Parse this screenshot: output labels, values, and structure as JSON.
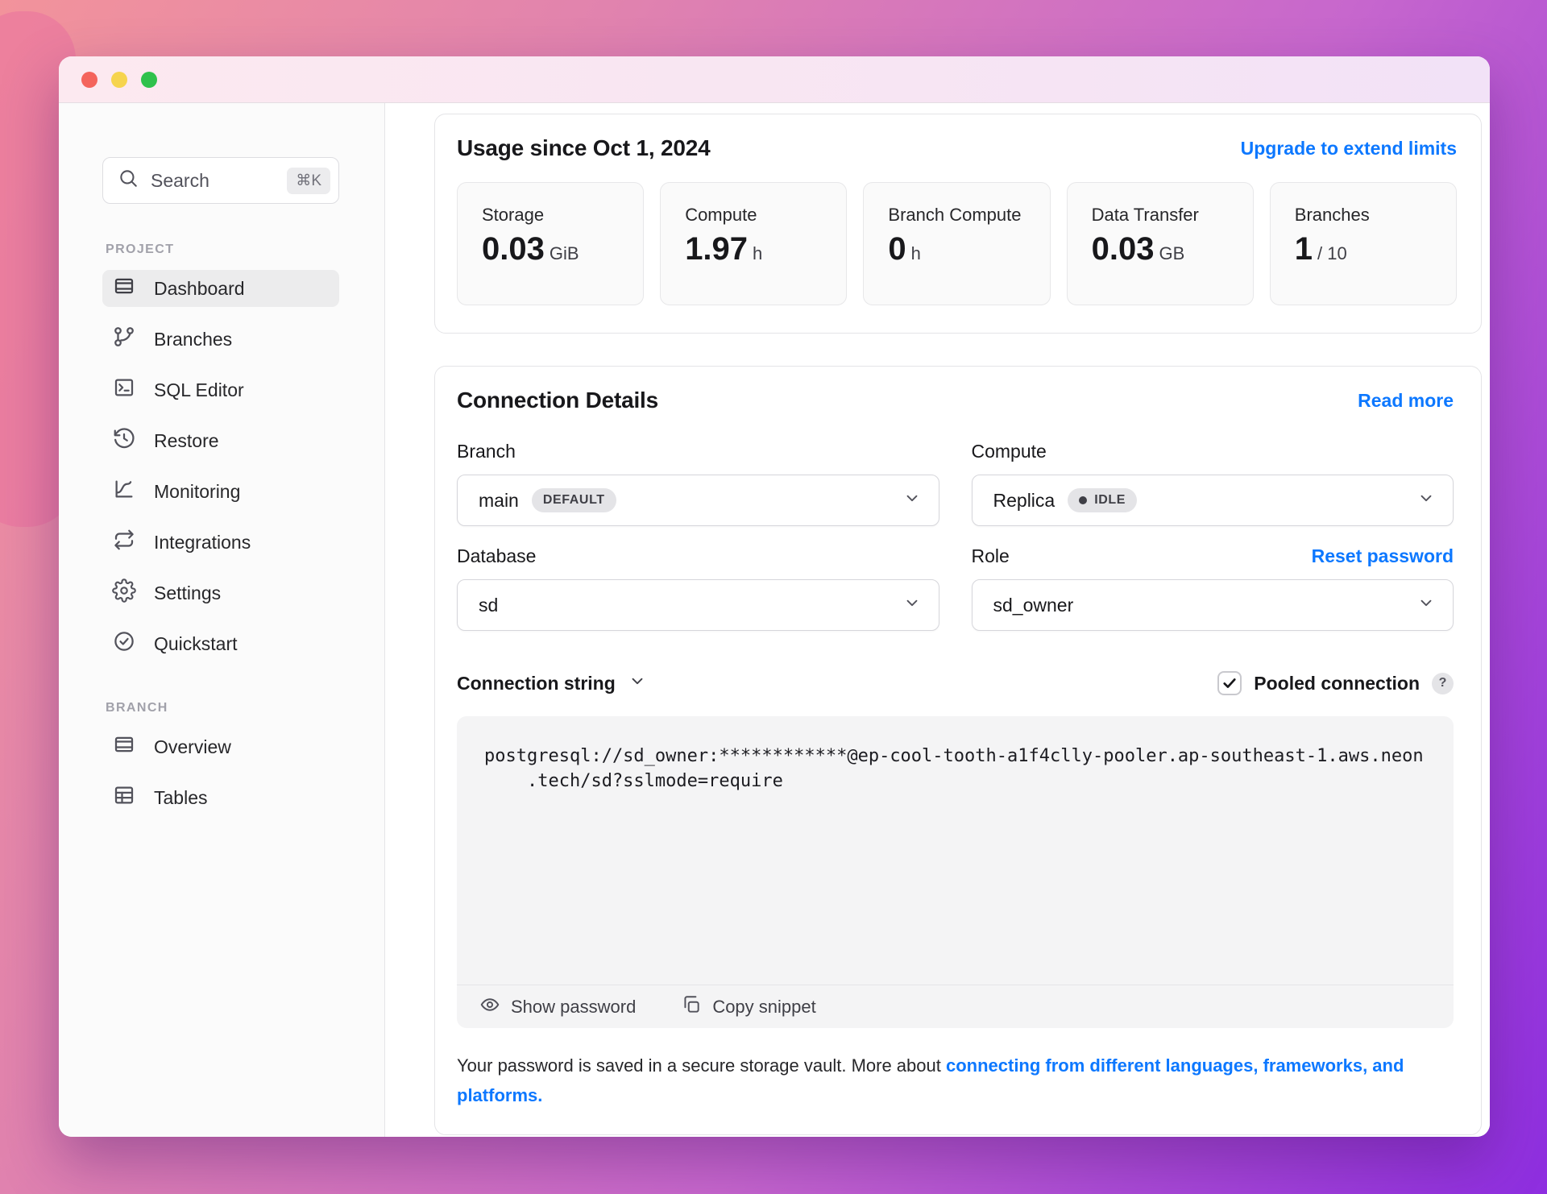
{
  "window": {
    "traffic_lights": {
      "close": "close",
      "minimize": "minimize",
      "zoom": "zoom"
    }
  },
  "sidebar": {
    "search": {
      "label": "Search",
      "shortcut": "⌘K"
    },
    "sections": [
      {
        "title": "PROJECT",
        "items": [
          {
            "label": "Dashboard"
          },
          {
            "label": "Branches"
          },
          {
            "label": "SQL Editor"
          },
          {
            "label": "Restore"
          },
          {
            "label": "Monitoring"
          },
          {
            "label": "Integrations"
          },
          {
            "label": "Settings"
          },
          {
            "label": "Quickstart"
          }
        ]
      },
      {
        "title": "BRANCH",
        "items": [
          {
            "label": "Overview"
          },
          {
            "label": "Tables"
          }
        ]
      }
    ]
  },
  "usage": {
    "title": "Usage since Oct 1, 2024",
    "upgrade_link": "Upgrade to extend limits",
    "metrics": [
      {
        "label": "Storage",
        "value": "0.03",
        "unit": "GiB"
      },
      {
        "label": "Compute",
        "value": "1.97",
        "unit": "h"
      },
      {
        "label": "Branch Compute",
        "value": "0",
        "unit": "h"
      },
      {
        "label": "Data Transfer",
        "value": "0.03",
        "unit": "GB"
      },
      {
        "label": "Branches",
        "value": "1",
        "unit": "/ 10"
      }
    ]
  },
  "connection": {
    "title": "Connection Details",
    "read_more": "Read more",
    "branch": {
      "label": "Branch",
      "value": "main",
      "badge": "DEFAULT"
    },
    "compute": {
      "label": "Compute",
      "value": "Replica",
      "badge": "IDLE"
    },
    "database": {
      "label": "Database",
      "value": "sd"
    },
    "role": {
      "label": "Role",
      "value": "sd_owner",
      "reset": "Reset password"
    },
    "string": {
      "label": "Connection string",
      "pooled": "Pooled connection",
      "help": "?",
      "code": "postgresql://sd_owner:************@ep-cool-tooth-a1f4clly-pooler.ap-southeast-1.aws.neon\n    .tech/sd?sslmode=require",
      "show_password": "Show password",
      "copy_snippet": "Copy snippet"
    },
    "footer": {
      "prefix": "Your password is saved in a secure storage vault. More about ",
      "link": "connecting from different languages, frameworks, and platforms."
    }
  },
  "colors": {
    "accent_blue": "#0d78ff",
    "traffic_red": "#f4645c",
    "traffic_yellow": "#f6d44e",
    "traffic_green": "#2fc14c",
    "background_gradient_start": "#f2939b",
    "background_gradient_end": "#8e2ee0"
  }
}
